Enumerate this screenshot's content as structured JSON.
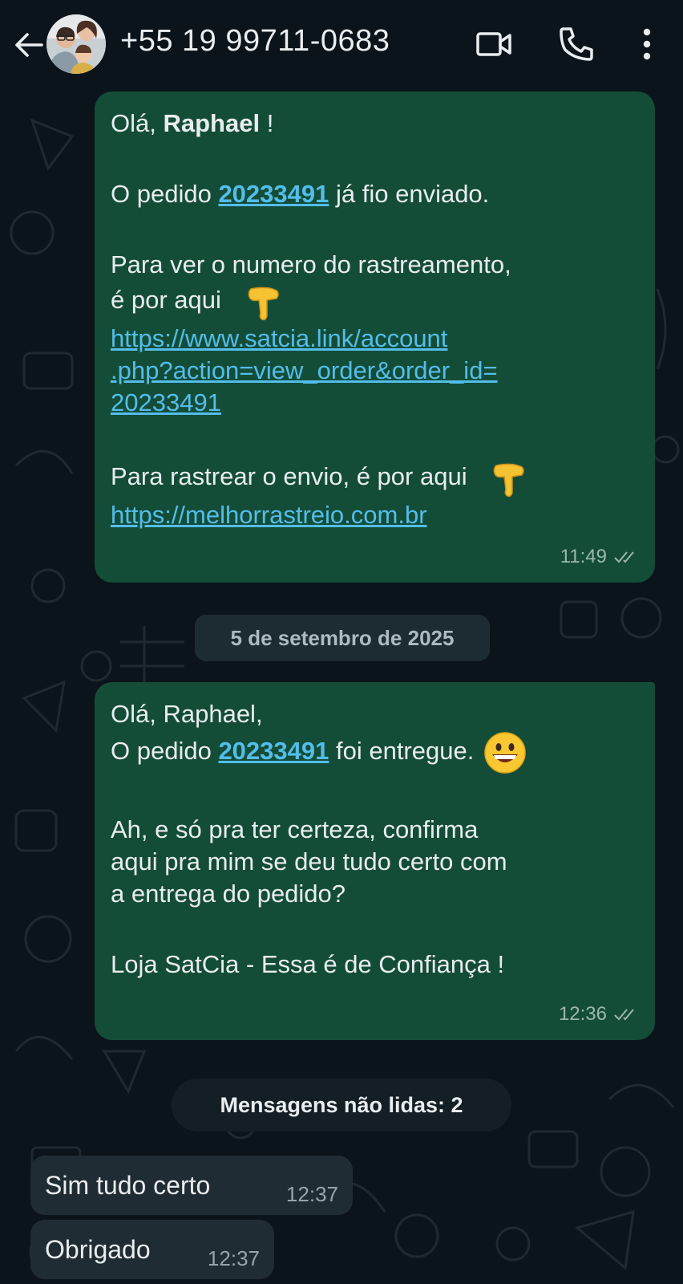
{
  "header": {
    "contact": "+55 19 99711-0683"
  },
  "messages": {
    "m1": {
      "greeting_pre": "Olá, ",
      "greeting_name": "Raphael",
      "greeting_post": " !",
      "order_pre": "O pedido ",
      "order_number": "20233491",
      "order_post": " já fio enviado.",
      "track_line1": "Para ver o numero do rastreamento,",
      "track_line2": "é por aqui",
      "link1_line1": "https://www.satcia.link/account",
      "link1_line2": ".php?action=view_order&order_id=",
      "link1_line3": "20233491",
      "track2": "Para rastrear o envio, é por aqui",
      "link2": "https://melhorrastreio.com.br",
      "time": "11:49"
    },
    "date_divider": "5 de setembro de 2025",
    "m2": {
      "greeting": "Olá, Raphael,",
      "order_pre": "O pedido ",
      "order_number": "20233491",
      "order_post": " foi entregue.",
      "confirm_line1": "Ah, e só pra ter certeza, confirma",
      "confirm_line2": "aqui pra mim se deu tudo certo com",
      "confirm_line3": "a entrega do pedido?",
      "signature": "Loja SatCia - Essa é de Confiança !",
      "time": "12:36"
    },
    "unread_divider": "Mensagens não lidas: 2",
    "r1": {
      "text": "Sim tudo certo",
      "time": "12:37"
    },
    "r2": {
      "text": "Obrigado",
      "time": "12:37"
    }
  },
  "colors": {
    "background": "#0b141a",
    "outgoing_bubble": "#144d37",
    "incoming_bubble": "#202c33",
    "link": "#53bdeb"
  },
  "icons": [
    "back-arrow-icon",
    "video-call-icon",
    "phone-icon",
    "more-vert-icon",
    "double-check-icon",
    "pointing-down-emoji",
    "grinning-face-emoji"
  ]
}
